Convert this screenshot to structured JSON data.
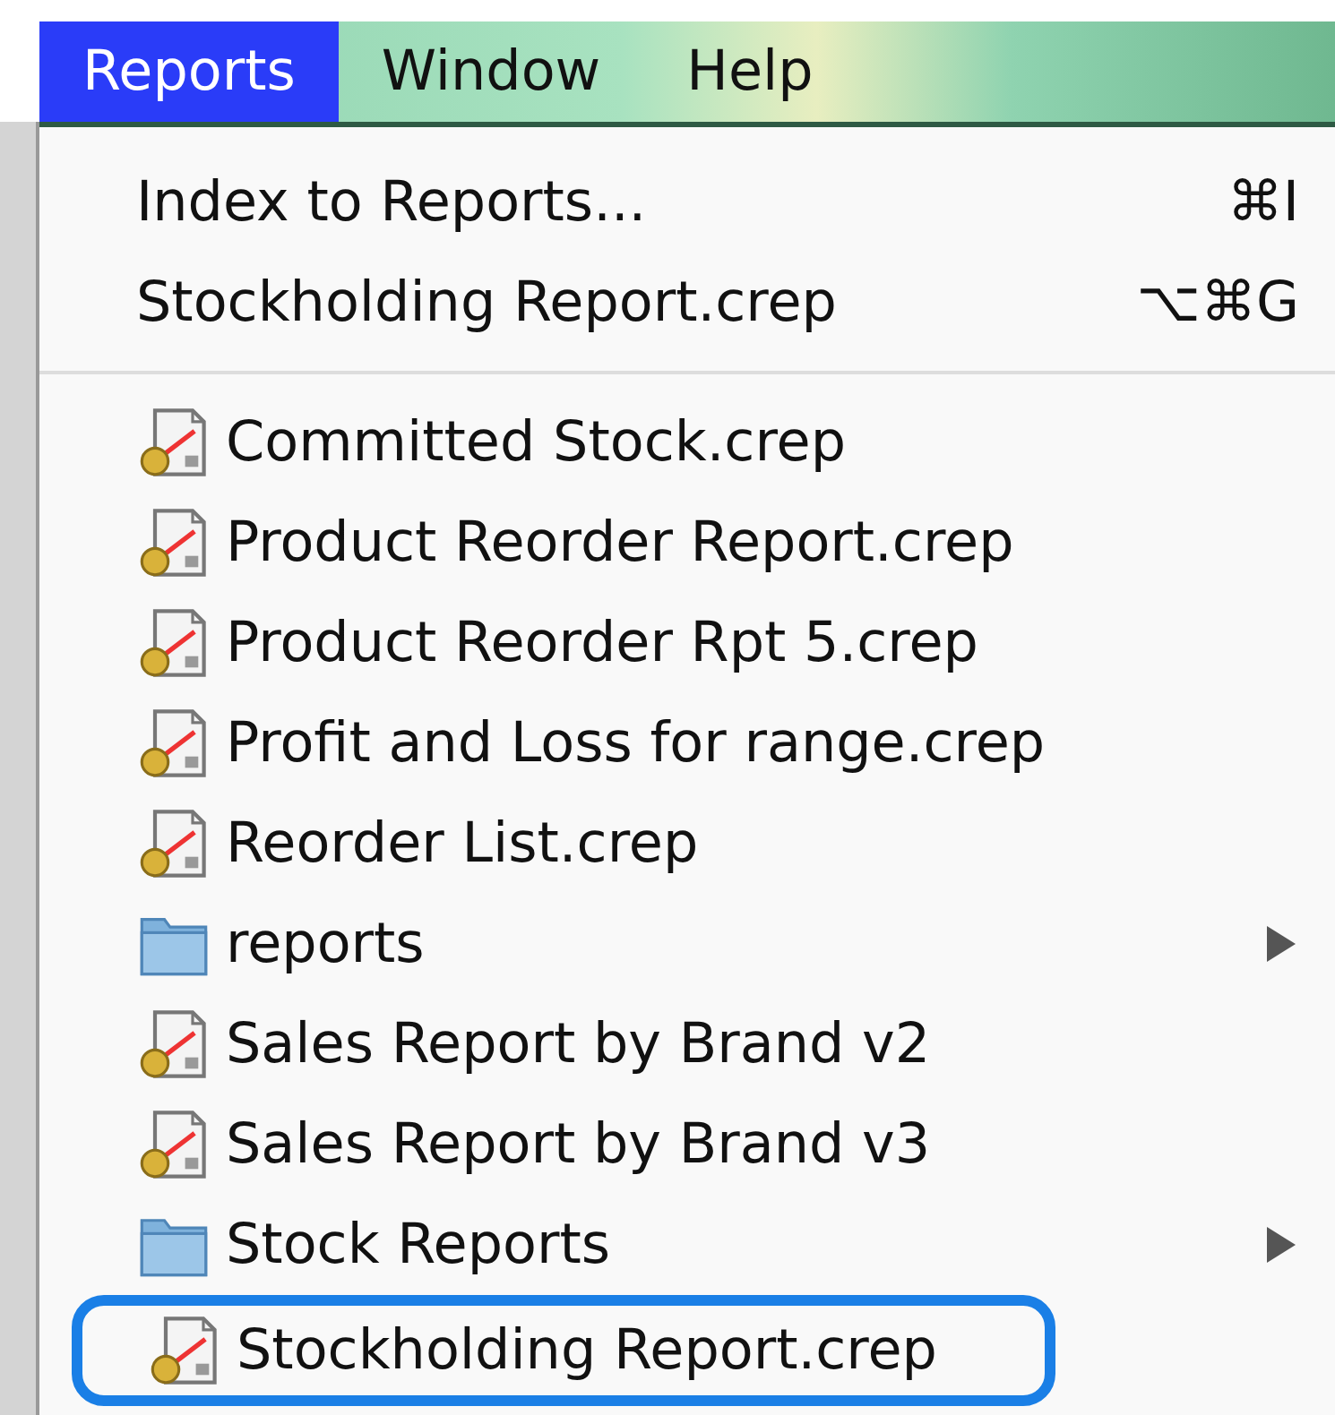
{
  "menu_bar": [
    {
      "label": "Reports",
      "selected": true
    },
    {
      "label": "Window",
      "selected": false
    },
    {
      "label": "Help",
      "selected": false
    }
  ],
  "menu_items": [
    {
      "kind": "command",
      "label": "Index to Reports...",
      "shortcut": "⌘I"
    },
    {
      "kind": "command",
      "label": "Stockholding Report.crep",
      "shortcut": "⌥⌘G"
    },
    {
      "kind": "separator"
    },
    {
      "kind": "file",
      "label": "Committed Stock.crep",
      "circled": false
    },
    {
      "kind": "file",
      "label": "Product Reorder Report.crep",
      "circled": false
    },
    {
      "kind": "file",
      "label": "Product Reorder Rpt 5.crep",
      "circled": false
    },
    {
      "kind": "file",
      "label": "Profit and Loss for range.crep",
      "circled": false
    },
    {
      "kind": "file",
      "label": "Reorder List.crep",
      "circled": false
    },
    {
      "kind": "folder",
      "label": "reports",
      "submenu": true
    },
    {
      "kind": "file",
      "label": "Sales Report by Brand v2",
      "circled": false
    },
    {
      "kind": "file",
      "label": "Sales Report by Brand v3",
      "circled": false
    },
    {
      "kind": "folder",
      "label": "Stock Reports",
      "submenu": true
    },
    {
      "kind": "file",
      "label": "Stockholding Report.crep",
      "circled": true
    }
  ]
}
